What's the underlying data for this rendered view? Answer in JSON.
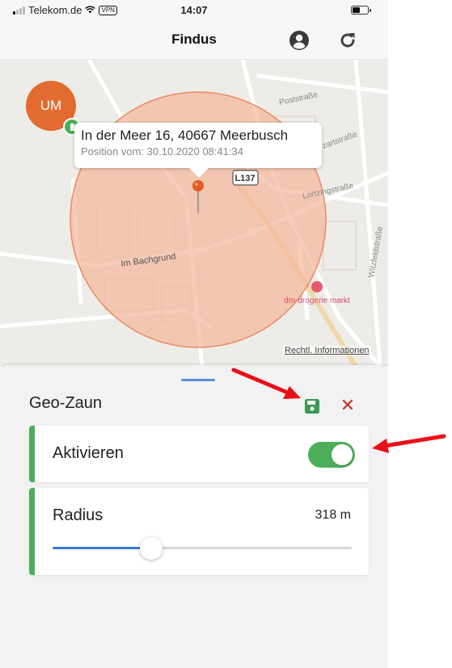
{
  "status_bar": {
    "carrier": "Telekom.de",
    "vpn_label": "VPN",
    "time": "14:07"
  },
  "header": {
    "title": "Findus",
    "profile_icon": "user-circle-icon",
    "refresh_icon": "refresh-icon"
  },
  "map": {
    "avatar_initials": "UM",
    "address": "In der Meer 16, 40667 Meerbusch",
    "position_date": "Position vom: 30.10.2020 08:41:34",
    "road_badge": "L137",
    "street_labels": {
      "im_bachgrund": "Im Bachgrund",
      "poststrasse": "Poststraße",
      "lortzingstrasse": "Lortzingstraße",
      "witzfeldstrasse": "Witzfeldstraße",
      "mozartstrasse": "zartstraße"
    },
    "poi_label": "dm-drogerie markt",
    "legal_link": "Rechtl. Informationen",
    "colors": {
      "geofence_fill": "#f3b79a",
      "geofence_stroke": "#e98a62",
      "pin": "#e35b22"
    }
  },
  "sheet": {
    "title": "Geo-Zaun",
    "save_icon": "save-icon",
    "close_icon": "close-icon",
    "activate": {
      "label": "Aktivieren",
      "enabled": true
    },
    "radius": {
      "label": "Radius",
      "value_text": "318 m",
      "slider_fraction": 0.33
    }
  },
  "colors": {
    "accent_green": "#4cae5b",
    "slider_blue": "#3b7bd6",
    "close_red": "#c0352b",
    "annotation_red": "#e8101a"
  }
}
